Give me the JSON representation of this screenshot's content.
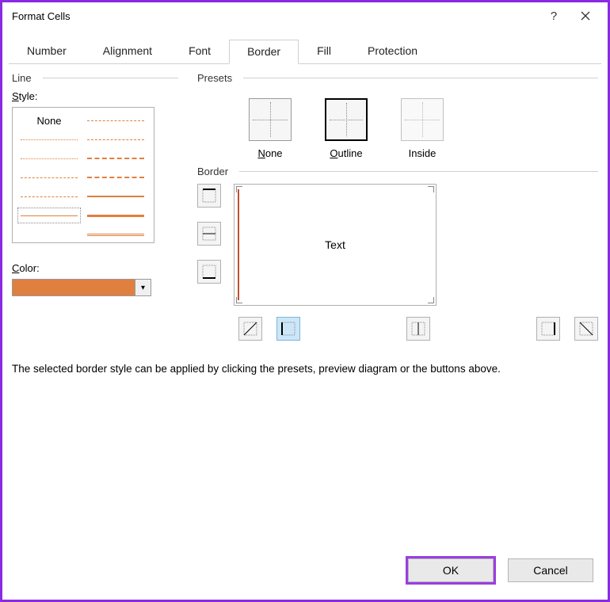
{
  "window": {
    "title": "Format Cells"
  },
  "tabs": {
    "items": [
      "Number",
      "Alignment",
      "Font",
      "Border",
      "Fill",
      "Protection"
    ],
    "active": "Border"
  },
  "line": {
    "group": "Line",
    "style_label": "Style:",
    "none": "None"
  },
  "color": {
    "label": "Color:",
    "value": "#e08040"
  },
  "presets": {
    "group": "Presets",
    "none": "None",
    "outline": "Outline",
    "inside": "Inside"
  },
  "border": {
    "group": "Border",
    "preview_text": "Text"
  },
  "hint": "The selected border style can be applied by clicking the presets, preview diagram or the buttons above.",
  "buttons": {
    "ok": "OK",
    "cancel": "Cancel"
  }
}
